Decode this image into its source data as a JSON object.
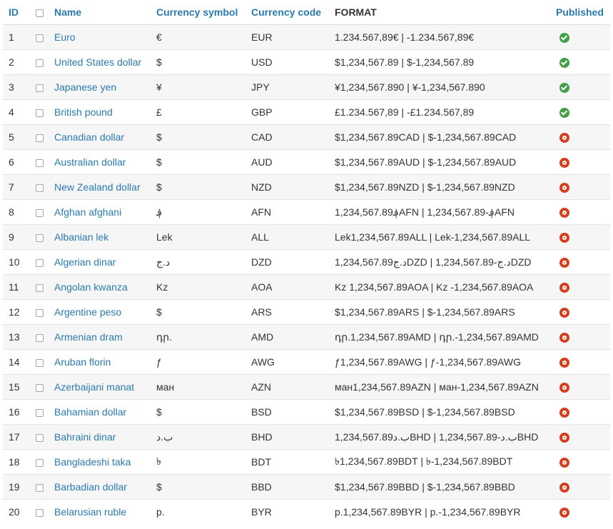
{
  "columns": {
    "id": "ID",
    "name": "Name",
    "symbol": "Currency symbol",
    "code": "Currency code",
    "format": "FORMAT",
    "published": "Published"
  },
  "colors": {
    "link": "#2a7ab0",
    "published": "#43a047",
    "unpublished": "#d2401e",
    "stripe": "#f6f6f6"
  },
  "rows": [
    {
      "id": "1",
      "name": "Euro",
      "symbol": "€",
      "code": "EUR",
      "format": "1.234.567,89€ | -1.234.567,89€",
      "published": true
    },
    {
      "id": "2",
      "name": "United States dollar",
      "symbol": "$",
      "code": "USD",
      "format": "$1,234,567.89 | $-1,234,567.89",
      "published": true
    },
    {
      "id": "3",
      "name": "Japanese yen",
      "symbol": "¥",
      "code": "JPY",
      "format": "¥1,234,567.890 | ¥-1,234,567.890",
      "published": true
    },
    {
      "id": "4",
      "name": "British pound",
      "symbol": "£",
      "code": "GBP",
      "format": "£1.234.567,89 | -£1.234.567,89",
      "published": true
    },
    {
      "id": "5",
      "name": "Canadian dollar",
      "symbol": "$",
      "code": "CAD",
      "format": "$1,234,567.89CAD | $-1,234,567.89CAD",
      "published": false
    },
    {
      "id": "6",
      "name": "Australian dollar",
      "symbol": "$",
      "code": "AUD",
      "format": "$1,234,567.89AUD | $-1,234,567.89AUD",
      "published": false
    },
    {
      "id": "7",
      "name": "New Zealand dollar",
      "symbol": "$",
      "code": "NZD",
      "format": "$1,234,567.89NZD | $-1,234,567.89NZD",
      "published": false
    },
    {
      "id": "8",
      "name": "Afghan afghani",
      "symbol": "؋",
      "code": "AFN",
      "format": "1,234,567.89؋AFN | 1,234,567.89-؋AFN",
      "published": false
    },
    {
      "id": "9",
      "name": "Albanian lek",
      "symbol": "Lek",
      "code": "ALL",
      "format": "Lek1,234,567.89ALL | Lek-1,234,567.89ALL",
      "published": false
    },
    {
      "id": "10",
      "name": "Algerian dinar",
      "symbol": "د.ج",
      "code": "DZD",
      "format": "1,234,567.89د.جDZD | 1,234,567.89-د.جDZD",
      "published": false
    },
    {
      "id": "11",
      "name": "Angolan kwanza",
      "symbol": "Kz",
      "code": "AOA",
      "format": "Kz 1,234,567.89AOA | Kz -1,234,567.89AOA",
      "published": false
    },
    {
      "id": "12",
      "name": "Argentine peso",
      "symbol": "$",
      "code": "ARS",
      "format": "$1,234,567.89ARS | $-1,234,567.89ARS",
      "published": false
    },
    {
      "id": "13",
      "name": "Armenian dram",
      "symbol": "դր.",
      "code": "AMD",
      "format": "դր.1,234,567.89AMD | դր.-1,234,567.89AMD",
      "published": false
    },
    {
      "id": "14",
      "name": "Aruban florin",
      "symbol": "ƒ",
      "code": "AWG",
      "format": "ƒ1,234,567.89AWG | ƒ-1,234,567.89AWG",
      "published": false
    },
    {
      "id": "15",
      "name": "Azerbaijani manat",
      "symbol": "ман",
      "code": "AZN",
      "format": "ман1,234,567.89AZN | ман-1,234,567.89AZN",
      "published": false
    },
    {
      "id": "16",
      "name": "Bahamian dollar",
      "symbol": "$",
      "code": "BSD",
      "format": "$1,234,567.89BSD | $-1,234,567.89BSD",
      "published": false
    },
    {
      "id": "17",
      "name": "Bahraini dinar",
      "symbol": "ب.د",
      "code": "BHD",
      "format": "1,234,567.89ب.دBHD | 1,234,567.89-ب.دBHD",
      "published": false
    },
    {
      "id": "18",
      "name": "Bangladeshi taka",
      "symbol": "৳",
      "code": "BDT",
      "format": "৳1,234,567.89BDT | ৳-1,234,567.89BDT",
      "published": false
    },
    {
      "id": "19",
      "name": "Barbadian dollar",
      "symbol": "$",
      "code": "BBD",
      "format": "$1,234,567.89BBD | $-1,234,567.89BBD",
      "published": false
    },
    {
      "id": "20",
      "name": "Belarusian ruble",
      "symbol": "p.",
      "code": "BYR",
      "format": "p.1,234,567.89BYR | p.-1,234,567.89BYR",
      "published": false
    }
  ]
}
